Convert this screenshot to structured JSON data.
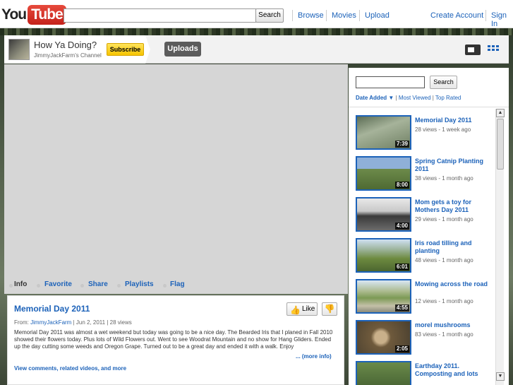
{
  "masthead": {
    "logo_you": "You",
    "logo_tube": "Tube",
    "search_button": "Search",
    "nav": [
      "Browse",
      "Movies",
      "Upload"
    ],
    "create_account": "Create Account",
    "sign_in": "Sign In"
  },
  "channel": {
    "title": "How Ya Doing?",
    "subtitle": "JimmyJackFarm's Channel",
    "subscribe": "Subscribe",
    "uploads": "Uploads"
  },
  "tabs": [
    "Info",
    "Favorite",
    "Share",
    "Playlists",
    "Flag"
  ],
  "video": {
    "title": "Memorial Day 2011",
    "like": "Like",
    "from_label": "From:",
    "from_user": "JimmyJackFarm",
    "from_rest": "| Jun 2, 2011  | 28 views",
    "description": "Memorial Day 2011 was almost a wet weekend but today was going to be a nice day. The Bearded Iris that I planed in Fall 2010 showed their flowers today. Plus lots of Wild Flowers out. Went to see Woodrat Mountain and no show for Hang Gliders. Ended up the day cutting some weeds and Oregon Grape. Turned out to be a great day and ended it with a walk. Enjoy",
    "more_info": "... (more info)",
    "view_comments": "View comments, related videos, and more"
  },
  "sidebar": {
    "search_button": "Search",
    "sort_active": "Date Added",
    "sort_options": [
      "Most Viewed",
      "Top Rated"
    ],
    "videos": [
      {
        "title": "Memorial Day 2011",
        "meta": "28 views - 1 week ago",
        "duration": "7:39"
      },
      {
        "title": "Spring Catnip Planting 2011",
        "meta": "38 views - 1 month ago",
        "duration": "8:00"
      },
      {
        "title": "Mom gets a toy for Mothers Day 2011",
        "meta": "29 views - 1 month ago",
        "duration": "4:00"
      },
      {
        "title": "Iris road tilling and planting",
        "meta": "48 views - 1 month ago",
        "duration": "6:01"
      },
      {
        "title": "Mowing across the road",
        "meta": "12 views - 1 month ago",
        "duration": "4:55"
      },
      {
        "title": "morel mushrooms",
        "meta": "83 views - 1 month ago",
        "duration": "2:05"
      },
      {
        "title": "Earthday 2011. Composting and lots",
        "meta": "",
        "duration": ""
      }
    ]
  }
}
